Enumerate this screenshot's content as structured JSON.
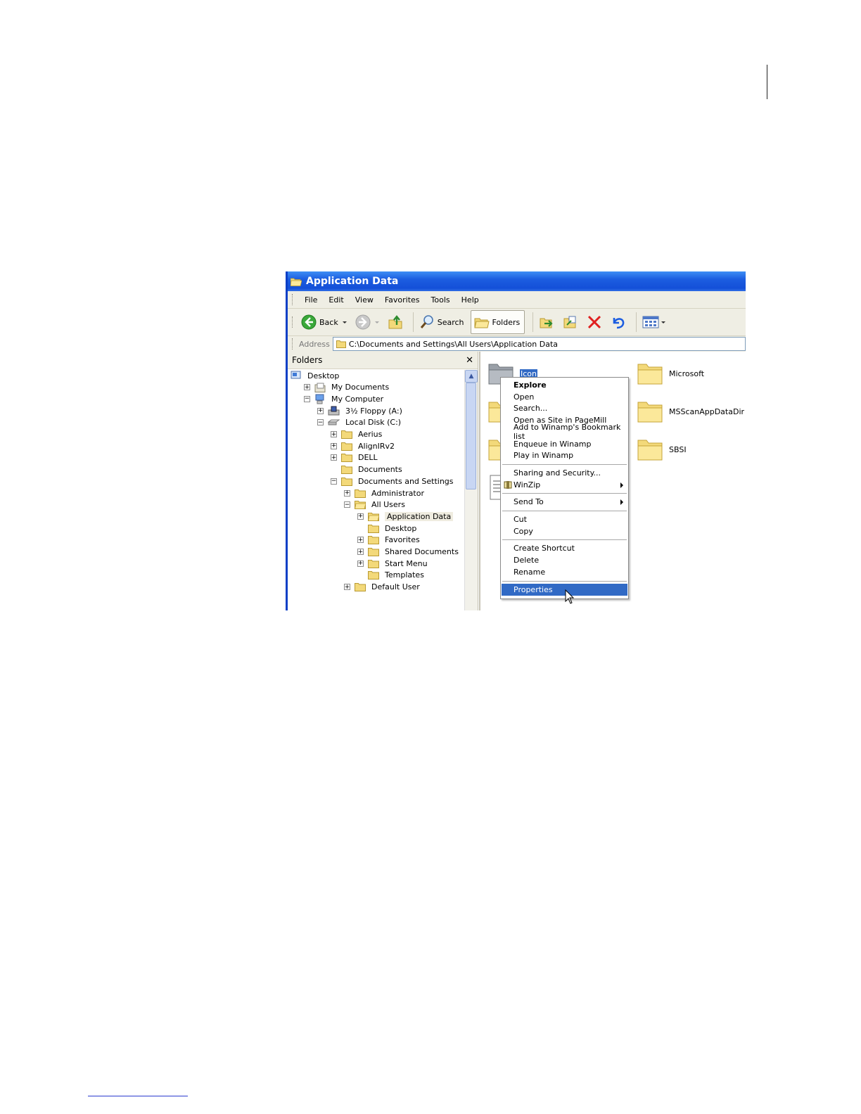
{
  "window": {
    "title": "Application Data"
  },
  "menu": [
    "File",
    "Edit",
    "View",
    "Favorites",
    "Tools",
    "Help"
  ],
  "toolbar": {
    "back": "Back",
    "search": "Search",
    "folders": "Folders"
  },
  "address": {
    "label": "Address",
    "value": "C:\\Documents and Settings\\All Users\\Application Data"
  },
  "folders_pane": {
    "title": "Folders",
    "close": "✕",
    "tree": [
      {
        "label": "Desktop",
        "level": 0,
        "expander": "",
        "icon": "desktop-icon"
      },
      {
        "label": "My Documents",
        "level": 1,
        "expander": "+",
        "icon": "my-documents-icon"
      },
      {
        "label": "My Computer",
        "level": 1,
        "expander": "−",
        "icon": "my-computer-icon"
      },
      {
        "label": "3½ Floppy (A:)",
        "level": 2,
        "expander": "+",
        "icon": "floppy-icon"
      },
      {
        "label": "Local Disk (C:)",
        "level": 2,
        "expander": "−",
        "icon": "disk-icon"
      },
      {
        "label": "Aerius",
        "level": 3,
        "expander": "+",
        "icon": "folder-icon"
      },
      {
        "label": "AlignIRv2",
        "level": 3,
        "expander": "+",
        "icon": "folder-icon"
      },
      {
        "label": "DELL",
        "level": 3,
        "expander": "+",
        "icon": "folder-icon"
      },
      {
        "label": "Documents",
        "level": 3,
        "expander": "",
        "icon": "folder-icon"
      },
      {
        "label": "Documents and Settings",
        "level": 3,
        "expander": "−",
        "icon": "folder-icon"
      },
      {
        "label": "Administrator",
        "level": 4,
        "expander": "+",
        "icon": "folder-icon"
      },
      {
        "label": "All Users",
        "level": 4,
        "expander": "−",
        "icon": "folder-open-icon"
      },
      {
        "label": "Application Data",
        "level": 5,
        "expander": "+",
        "icon": "folder-open-icon",
        "selected": true
      },
      {
        "label": "Desktop",
        "level": 5,
        "expander": "",
        "icon": "folder-icon"
      },
      {
        "label": "Favorites",
        "level": 5,
        "expander": "+",
        "icon": "folder-icon"
      },
      {
        "label": "Shared Documents",
        "level": 5,
        "expander": "+",
        "icon": "folder-icon"
      },
      {
        "label": "Start Menu",
        "level": 5,
        "expander": "+",
        "icon": "folder-icon"
      },
      {
        "label": "Templates",
        "level": 5,
        "expander": "",
        "icon": "folder-icon"
      },
      {
        "label": "Default User",
        "level": 4,
        "expander": "+",
        "icon": "folder-icon"
      }
    ]
  },
  "files": [
    {
      "name": "Icon",
      "selected": true
    },
    {
      "name": "Microsoft"
    },
    {
      "name": "MSScanAppDataDir"
    },
    {
      "name": "SBSI"
    }
  ],
  "context_menu": [
    {
      "label": "Explore",
      "bold": true
    },
    {
      "label": "Open"
    },
    {
      "label": "Search..."
    },
    {
      "label": "Open as Site in PageMill"
    },
    {
      "label": "Add to Winamp's Bookmark list"
    },
    {
      "label": "Enqueue in Winamp"
    },
    {
      "label": "Play in Winamp"
    },
    {
      "separator": true
    },
    {
      "label": "Sharing and Security..."
    },
    {
      "label": "WinZip",
      "submenu": true,
      "icon": "winzip-icon"
    },
    {
      "separator": true
    },
    {
      "label": "Send To",
      "submenu": true
    },
    {
      "separator": true
    },
    {
      "label": "Cut"
    },
    {
      "label": "Copy"
    },
    {
      "separator": true
    },
    {
      "label": "Create Shortcut"
    },
    {
      "label": "Delete"
    },
    {
      "label": "Rename"
    },
    {
      "separator": true
    },
    {
      "label": "Properties",
      "highlighted": true
    }
  ],
  "colors": {
    "titlebar": "#1c5de0",
    "highlight": "#316ac5",
    "chrome": "#ece9d8"
  }
}
